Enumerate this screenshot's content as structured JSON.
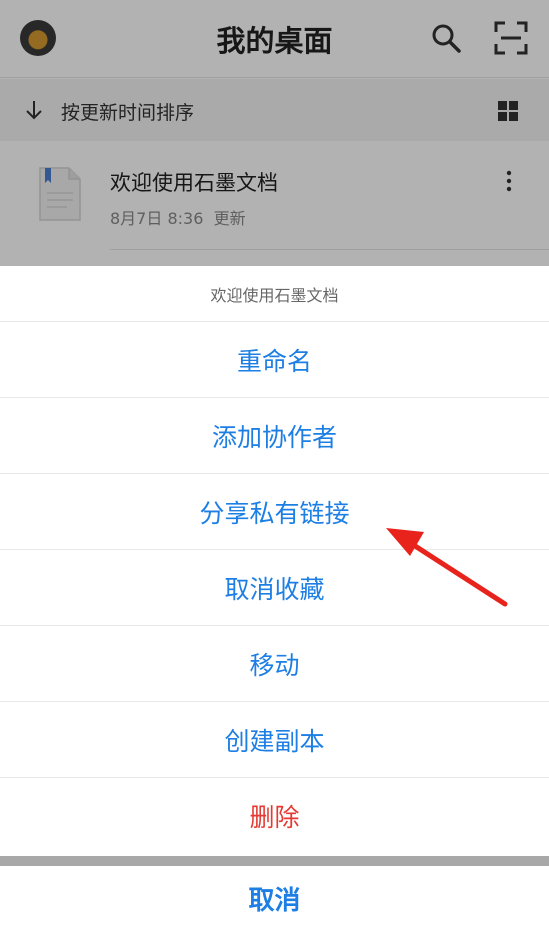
{
  "header": {
    "title": "我的桌面",
    "avatar_icon": "user-avatar",
    "search_icon": "search-icon",
    "scan_icon": "scan-icon"
  },
  "sortbar": {
    "label": "按更新时间排序",
    "sort_icon": "arrow-down-icon",
    "view_icon": "grid-view-icon"
  },
  "document": {
    "title": "欢迎使用石墨文档",
    "date": "8月7日 8:36",
    "status": "更新",
    "more_icon": "more-vertical-icon"
  },
  "action_sheet": {
    "title": "欢迎使用石墨文档",
    "items": [
      {
        "label": "重命名"
      },
      {
        "label": "添加协作者"
      },
      {
        "label": "分享私有链接"
      },
      {
        "label": "取消收藏"
      },
      {
        "label": "移动"
      },
      {
        "label": "创建副本"
      },
      {
        "label": "删除",
        "danger": true
      }
    ],
    "cancel": "取消"
  },
  "colors": {
    "accent": "#1d7fe4",
    "danger": "#e53a33",
    "annotation": "#e8231c"
  }
}
